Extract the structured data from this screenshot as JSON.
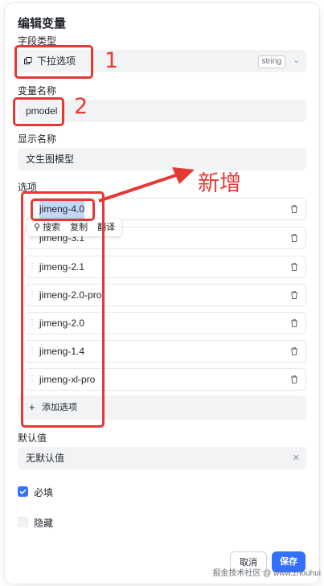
{
  "dialog": {
    "title": "编辑变量"
  },
  "field_type": {
    "label": "字段类型",
    "value": "下拉选项",
    "type_chip": "string"
  },
  "var_name": {
    "label": "变量名称",
    "value": "pmodel"
  },
  "display_name": {
    "label": "显示名称",
    "value": "文生图模型"
  },
  "options": {
    "label": "选项",
    "items": [
      "jimeng-4.0",
      "jimeng-3.1",
      "jimeng-2.1",
      "jimeng-2.0-pro",
      "jimeng-2.0",
      "jimeng-1.4",
      "jimeng-xl-pro"
    ],
    "add_label": "添加选项"
  },
  "selection_toolbar": {
    "search": "搜索",
    "copy": "复制",
    "translate": "翻译"
  },
  "default_value": {
    "label": "默认值",
    "value": "无默认值"
  },
  "checkboxes": {
    "required_label": "必填",
    "hidden_label": "隐藏"
  },
  "footer": {
    "cancel": "取消",
    "save": "保存"
  },
  "annotations": {
    "n1": "1",
    "n2": "2",
    "new_text": "新增"
  },
  "watermark": "掘金技术社区 @ www.zhouhui",
  "colors": {
    "accent": "#3370ff",
    "annotation": "#e53935"
  }
}
